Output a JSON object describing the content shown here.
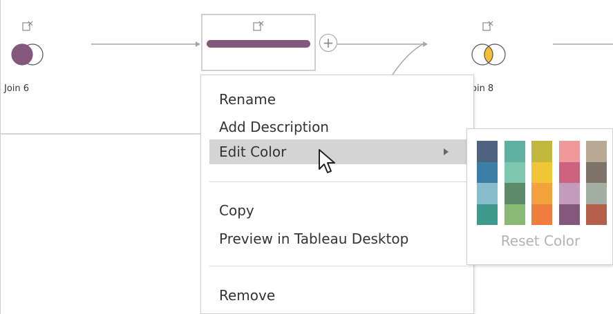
{
  "canvas": {
    "nodes": [
      {
        "label": "Join 6",
        "icon": "note-icon"
      },
      {
        "label": "",
        "icon": "note-icon",
        "selected": true,
        "color": "#84577c"
      },
      {
        "label": "oin 8",
        "icon": "note-icon"
      }
    ],
    "join6_circle_color": "#84577c",
    "join8_overlap_color": "#f2c037"
  },
  "context_menu": {
    "items": [
      {
        "label": "Rename"
      },
      {
        "label": "Add Description"
      },
      {
        "label": "Edit Color",
        "has_submenu": true,
        "highlighted": true
      },
      {
        "label": "Copy"
      },
      {
        "label": "Preview in Tableau Desktop"
      },
      {
        "label": "Remove"
      }
    ]
  },
  "color_palette": {
    "columns": [
      [
        "#4e6380",
        "#3d7ea7",
        "#86bccb",
        "#3f9a8d"
      ],
      [
        "#5fb0a0",
        "#7fc6ae",
        "#5d8a6a",
        "#8ab875"
      ],
      [
        "#c3b83e",
        "#f0c537",
        "#f4a23b",
        "#ef7d3d"
      ],
      [
        "#ef999b",
        "#cd627f",
        "#c39bbb",
        "#84577c"
      ],
      [
        "#b8a894",
        "#7d7369",
        "#a3b0a1",
        "#b45f4c"
      ]
    ],
    "reset_label": "Reset Color"
  }
}
